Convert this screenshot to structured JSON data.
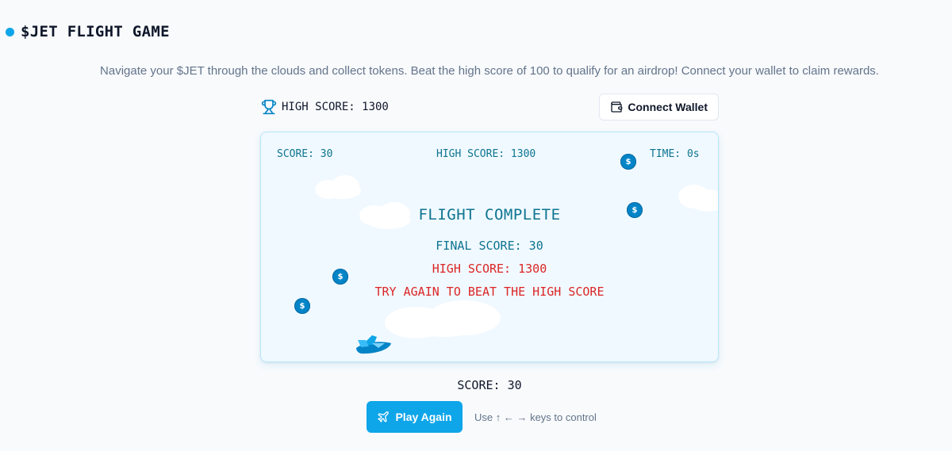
{
  "header": {
    "title": "$JET FLIGHT GAME",
    "description": "Navigate your $JET through the clouds and collect tokens. Beat the high score of 100 to qualify for an airdrop! Connect your wallet to claim rewards."
  },
  "topbar": {
    "high_score_label": "HIGH SCORE: 1300",
    "trophy_icon": "trophy-icon",
    "connect_wallet_label": "Connect Wallet",
    "wallet_icon": "wallet-icon"
  },
  "game": {
    "hud": {
      "score": "SCORE: 30",
      "high_score": "HIGH SCORE: 1300",
      "time": "TIME: 0s"
    },
    "overlay": {
      "heading": "FLIGHT COMPLETE",
      "final_score": "FINAL SCORE: 30",
      "high_score": "HIGH SCORE: 1300",
      "message": "TRY AGAIN TO BEAT THE HIGH SCORE"
    },
    "coin_symbol": "$",
    "colors": {
      "sky": "#f0f9ff",
      "accent": "#0ea5e9",
      "coin": "#0284c7",
      "alert": "#dc2626",
      "hud_text": "#0e7490"
    }
  },
  "footer": {
    "score_label": "SCORE: 30",
    "play_again_label": "Play Again",
    "plane_icon": "plane-icon",
    "controls_hint": "Use ↑ ← → keys to control"
  }
}
